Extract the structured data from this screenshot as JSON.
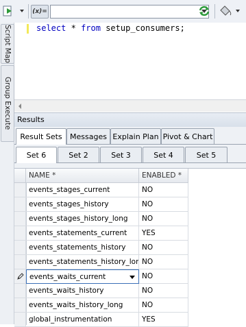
{
  "toolbar": {
    "variables_label": "(x)=",
    "combo_value": ""
  },
  "sidebar": {
    "tabs": [
      {
        "label": "Script Map"
      },
      {
        "label": "Group Execute"
      }
    ]
  },
  "editor": {
    "tokens": [
      "select",
      "*",
      "from",
      "setup_consumers;"
    ]
  },
  "results": {
    "title": "Results",
    "tabs": [
      {
        "label": "Result Sets",
        "active": true
      },
      {
        "label": "Messages"
      },
      {
        "label": "Explain Plan"
      },
      {
        "label": "Pivot & Chart"
      }
    ],
    "sets": [
      {
        "label": "Set 6",
        "active": true
      },
      {
        "label": "Set 2"
      },
      {
        "label": "Set 3"
      },
      {
        "label": "Set 4"
      },
      {
        "label": "Set 5"
      }
    ],
    "columns": [
      "NAME *",
      "ENABLED *"
    ],
    "rows": [
      [
        "events_stages_current",
        "NO"
      ],
      [
        "events_stages_history",
        "NO"
      ],
      [
        "events_stages_history_long",
        "NO"
      ],
      [
        "events_statements_current",
        "YES"
      ],
      [
        "events_statements_history",
        "NO"
      ],
      [
        "events_statements_history_long",
        "NO"
      ],
      [
        "events_waits_current",
        "NO"
      ],
      [
        "events_waits_history",
        "NO"
      ],
      [
        "events_waits_history_long",
        "NO"
      ],
      [
        "global_instrumentation",
        "YES"
      ]
    ],
    "editing_row_index": 6
  }
}
